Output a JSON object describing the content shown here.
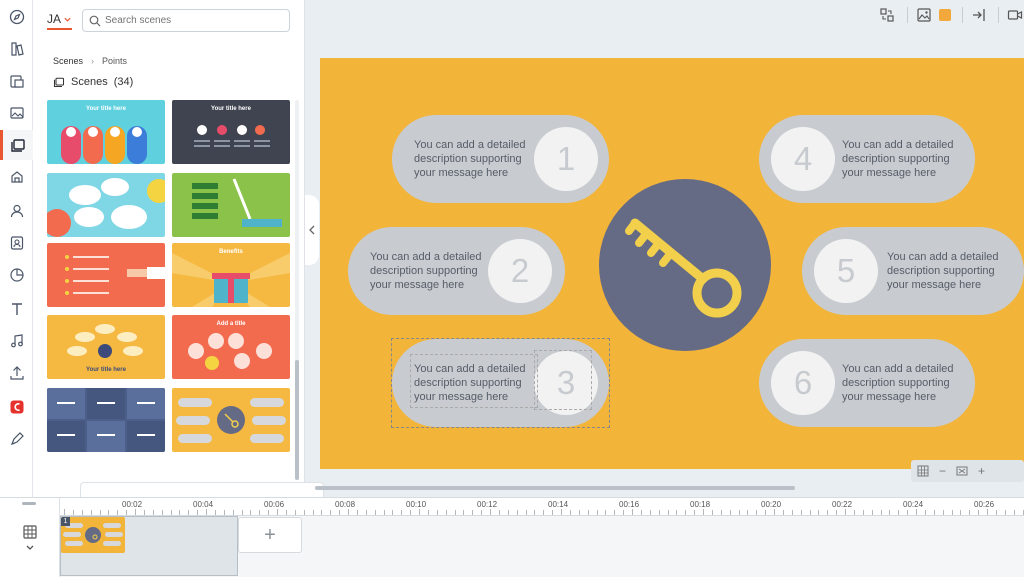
{
  "rail": {
    "items": [
      {
        "name": "explore-icon",
        "active": false
      },
      {
        "name": "templates-icon",
        "active": false
      },
      {
        "name": "my-files-icon",
        "active": false
      },
      {
        "name": "backgrounds-icon",
        "active": false
      },
      {
        "name": "scenes-icon",
        "active": true
      },
      {
        "name": "props-icon",
        "active": false
      },
      {
        "name": "characters-icon",
        "active": false
      },
      {
        "name": "character-builder-icon",
        "active": false
      },
      {
        "name": "charts-icon",
        "active": false
      },
      {
        "name": "text-icon",
        "active": false
      },
      {
        "name": "audio-icon",
        "active": false
      },
      {
        "name": "upload-icon",
        "active": false
      },
      {
        "name": "brand-app-icon",
        "active": false
      },
      {
        "name": "drawing-icon",
        "active": false
      }
    ]
  },
  "panel": {
    "language": "JA",
    "search_placeholder": "Search scenes",
    "breadcrumb": {
      "root": "Scenes",
      "current": "Points"
    },
    "scenes_label": "Scenes",
    "scenes_count": "(34)",
    "thumbnails": [
      {
        "title": "Your title here",
        "bg": "#5fd0de"
      },
      {
        "title": "Your title here",
        "bg": "#3f4450"
      },
      {
        "title": "",
        "bg": "#7fd6e4"
      },
      {
        "title": "",
        "bg": "#8bc34a"
      },
      {
        "title": "",
        "bg": "#f26b4f"
      },
      {
        "title": "Benefits",
        "bg": "#f5b942"
      },
      {
        "title": "Your title here",
        "bg": "#f5b942"
      },
      {
        "title": "Add a title",
        "bg": "#f26b4f"
      },
      {
        "title": "",
        "bg": "#4c5f8a"
      },
      {
        "title": "",
        "bg": "#f5b942"
      }
    ]
  },
  "canvas": {
    "bg_color": "#f3b43a",
    "hub_color": "#656a85",
    "key_color": "#f2d04b",
    "points": [
      {
        "num": "1",
        "text": "You can add a detailed description supporting your message here"
      },
      {
        "num": "2",
        "text": "You can add a detailed description supporting your message here"
      },
      {
        "num": "3",
        "text": "You can add a detailed description supporting your message here"
      },
      {
        "num": "4",
        "text": "You can add a detailed description supporting your message here"
      },
      {
        "num": "5",
        "text": "You can add a detailed description supporting your message here"
      },
      {
        "num": "6",
        "text": "You can add a detailed description supporting your message here"
      }
    ]
  },
  "timeline": {
    "ticks": [
      "00:02",
      "00:04",
      "00:06",
      "00:08",
      "00:10",
      "00:12",
      "00:14",
      "00:16",
      "00:18",
      "00:20",
      "00:22",
      "00:24",
      "00:26"
    ],
    "scene_number": "1",
    "add_label": "+"
  },
  "zoom": {
    "minus": "−",
    "plus": "+"
  }
}
